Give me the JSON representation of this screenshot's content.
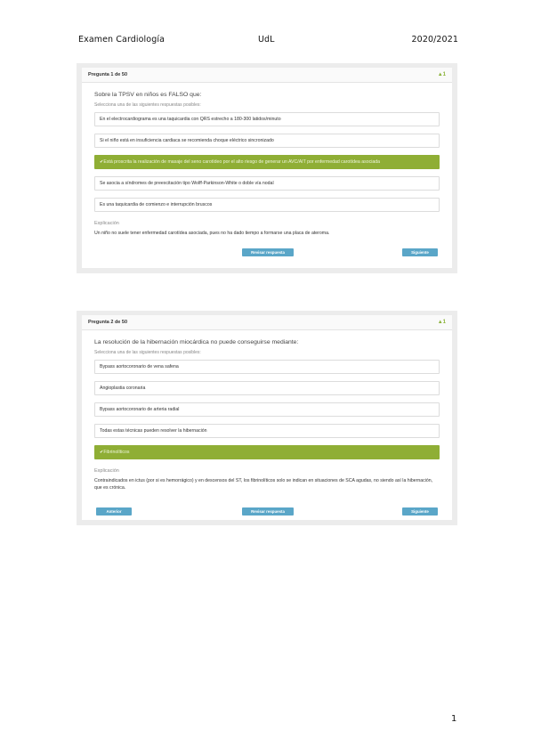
{
  "header": {
    "left": "Examen Cardiología",
    "center": "UdL",
    "right": "2020/2021"
  },
  "page_number": "1",
  "questions": [
    {
      "title": "Pregunta 1 de 50",
      "icon": "tree-icon",
      "icon_text": "1",
      "prompt": "Sobre la TPSV en niños es FALSO que:",
      "instruction": "Selecciona una de las siguientes respuestas posibles:",
      "options": [
        "En el electrocardiograma es una taquicardia con QRS estrecho a 180-300 latidos/minuto",
        "Si el niño está en insuficiencia cardiaca se recomienda choque eléctrico sincronizado",
        "Está proscrita la realización de masaje del seno carotídeo por el alto riesgo de generar un AVC/AIT por enfermedad carotídea asociada",
        "Se asocia a síndromes de preexcitación tipo Wolff-Parkinson-White o doble vía nodal",
        "Es una taquicardia de comienzo e interrupción bruscos"
      ],
      "correct_index": 2,
      "explanation_label": "Explicación",
      "explanation": "Un niño no suele tener enfermedad carotídea asociada, pues no ha dado tiempo a formarse una placa de ateroma.",
      "review_label": "Revisar respuesta",
      "next_label": "Siguiente"
    },
    {
      "title": "Pregunta 2 de 50",
      "icon": "tree-icon",
      "icon_text": "1",
      "prompt": "La resolución de la hibernación miocárdica no puede conseguirse mediante:",
      "instruction": "Selecciona una de las siguientes respuestas posibles:",
      "options": [
        "Bypass aortocoronario de vena safena",
        "Angioplastia coronaria",
        "Bypass aortocoronario de arteria radial",
        "Todas estas técnicas pueden resolver la hibernación",
        "Fibrinolíticos"
      ],
      "correct_index": 4,
      "explanation_label": "Explicación",
      "explanation": "Contraindicados en ictus (por si es hemorrágico) y en descensos del ST, los fibrinolíticos solo se indican en situaciones de SCA agudas, no siendo así la hibernación, que es crónica.",
      "prev_label": "Anterior",
      "review_label": "Revisar respuesta",
      "next_label": "Siguiente"
    }
  ],
  "colors": {
    "correct": "#8fae35",
    "button": "#5aa6c8"
  }
}
